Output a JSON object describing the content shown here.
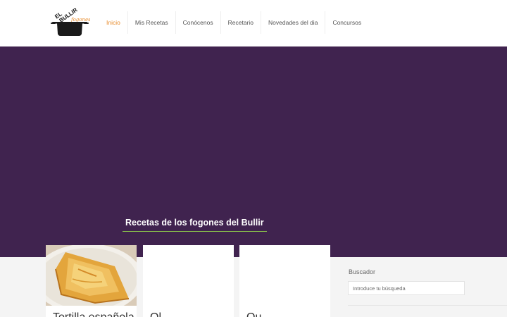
{
  "brand": {
    "logo_text_line1": "EL",
    "logo_text_line2": "BULLIR",
    "logo_text_line3": "DE",
    "logo_script": "fogones"
  },
  "nav": {
    "items": [
      {
        "label": "Inicio",
        "active": true
      },
      {
        "label": "Mis Recetas",
        "active": false
      },
      {
        "label": "Conócenos",
        "active": false
      },
      {
        "label": "Recetario",
        "active": false
      },
      {
        "label": "Novedades del dia",
        "active": false
      },
      {
        "label": "Concursos",
        "active": false
      }
    ]
  },
  "hero": {
    "section_title": "Recetas de los fogones del Bullir"
  },
  "cards": [
    {
      "title": "Tortilla española",
      "image": "tortilla-photo"
    },
    {
      "title": "Ol",
      "image": "blank"
    },
    {
      "title": "Qu",
      "image": "blank"
    }
  ],
  "sidebar": {
    "search_label": "Buscador",
    "search_placeholder": "Introduce tu búsqueda"
  },
  "colors": {
    "hero_bg": "#40234f",
    "active_nav": "#e88c2d",
    "title_underline": "#8bc34a"
  }
}
